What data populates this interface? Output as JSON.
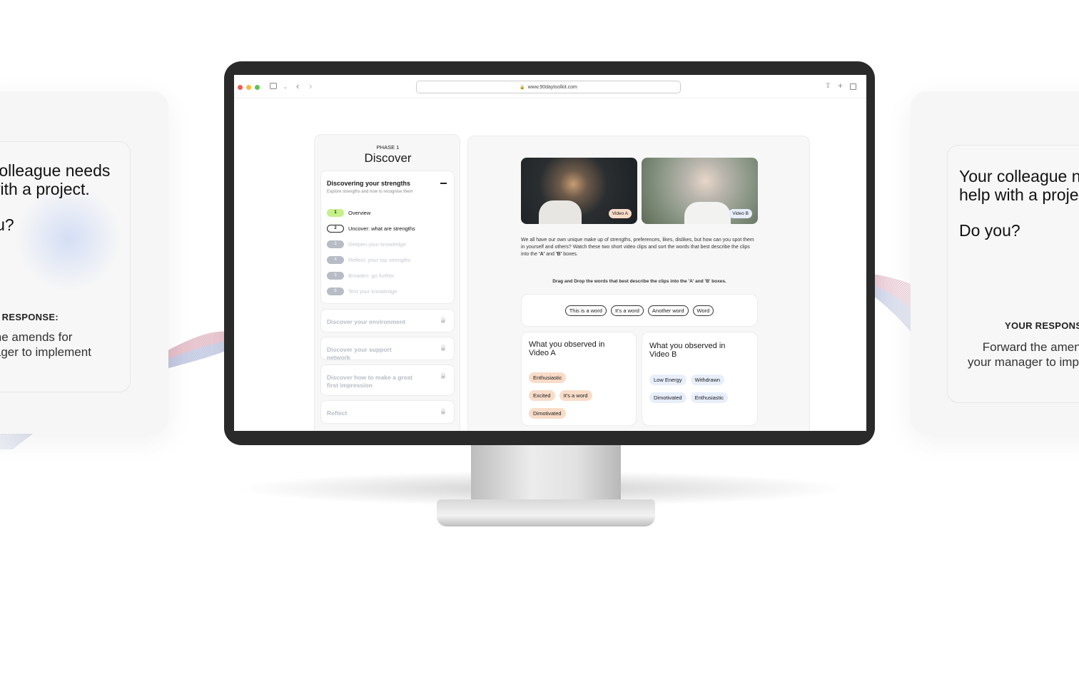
{
  "left_card": {
    "question_line1": "Your colleague needs",
    "question_line2": "help with a project.",
    "question_line3": "Do you?",
    "response_label": "YOUR RESPONSE:",
    "response_line1": "Forward the amends for",
    "response_line2": "your manager to implement"
  },
  "right_card": {
    "question_line1": "Your colleague needs",
    "question_line2": "help with a project.",
    "question_line3": "Do you?",
    "response_label": "YOUR RESPONSE:",
    "response_line1": "Forward the amends for",
    "response_line2": "your manager to implement"
  },
  "browser": {
    "url": "www.90daytoolkit.com"
  },
  "sidebar": {
    "phase": "PHASE 1",
    "title": "Discover",
    "section": {
      "title": "Discovering your strengths",
      "subtitle": "Explore strengths and how to recognise them",
      "steps": [
        {
          "num": "1",
          "label": "Overview",
          "state": "done"
        },
        {
          "num": "2",
          "label": "Uncover: what are strengths",
          "state": "current"
        },
        {
          "num": "3",
          "label": "Deepen your knowledge",
          "state": "locked"
        },
        {
          "num": "4",
          "label": "Reflect: your top strengths",
          "state": "locked"
        },
        {
          "num": "5",
          "label": "Broaden: go further",
          "state": "locked"
        },
        {
          "num": "6",
          "label": "Test your knowledge",
          "state": "locked"
        }
      ]
    },
    "locked_sections": [
      "Discover your environment",
      "Discover your support network",
      "Discover how to make a great first impression",
      "Reflect"
    ]
  },
  "main": {
    "video_a_label": "Video A",
    "video_b_label": "Video B",
    "intro_before": "We all have our own unique make up of strengths, preferences, likes, dislikes, but how can you spot them in yourself and others? Watch these two short video clips and sort the words that best describe the clips into the ",
    "intro_a": "'A'",
    "intro_and": " and ",
    "intro_b": "'B'",
    "intro_after": " boxes.",
    "instruction_before": "Drag and Drop the words that best describe the clips into the ",
    "instruction_a": "'A'",
    "instruction_and": " and ",
    "instruction_b": "'B'",
    "instruction_after": " boxes.",
    "word_bank": [
      "This is a word",
      "It's a word",
      "Another word",
      "Word"
    ],
    "box_a": {
      "title": "What you observed in Video A",
      "words": [
        "Enthusiastic",
        "Excited",
        "It's a word",
        "Dimotivated"
      ]
    },
    "box_b": {
      "title": "What you observed in Video B",
      "words": [
        "Low Energy",
        "Withdrawn",
        "Dimotivated",
        "Enthusiastic"
      ]
    }
  },
  "colors": {
    "accent_done": "#c6f08a",
    "chip_a": "#f8dcc8",
    "chip_b": "#e8eefa",
    "bezel": "#2a2a2a"
  }
}
